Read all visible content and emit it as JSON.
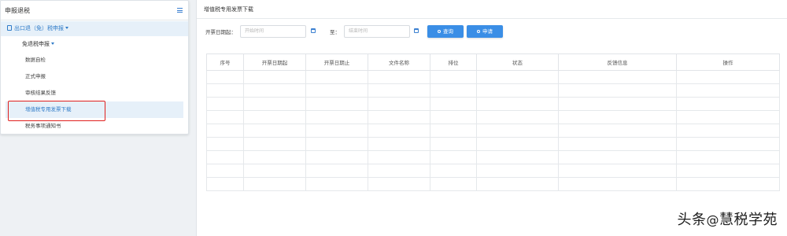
{
  "sidebar": {
    "title": "申报退税",
    "menu_icon": "hamburger-menu-icon",
    "group": {
      "label": "出口退（免）税申报",
      "icon": "document-icon"
    },
    "sub": {
      "label": "免退税申报"
    },
    "items": [
      {
        "label": "数据自检"
      },
      {
        "label": "正式申报"
      },
      {
        "label": "审核结果反馈"
      },
      {
        "label": "增值税专用发票下载"
      },
      {
        "label": "税务事项通知书"
      }
    ],
    "active_item": "增值税专用发票下载",
    "highlight_color": "#e0201e"
  },
  "main": {
    "title": "增值税专用发票下载",
    "filter": {
      "start_label": "开票日期起：",
      "start_placeholder": "开始时间",
      "to_label": "至：",
      "end_placeholder": "结束时间",
      "query_button": "查询",
      "apply_button": "申请"
    },
    "table": {
      "headers": [
        "序号",
        "开票日期起",
        "开票日期止",
        "文件名称",
        "排位",
        "状态",
        "反馈信息",
        "操作"
      ],
      "empty_rows": 9
    }
  },
  "colors": {
    "accent": "#3a8ee6",
    "active_bg": "#e6f0f9",
    "active_text": "#2f7bc8"
  },
  "watermark": {
    "prefix": "头条",
    "at": "@",
    "name": "慧税学苑"
  }
}
